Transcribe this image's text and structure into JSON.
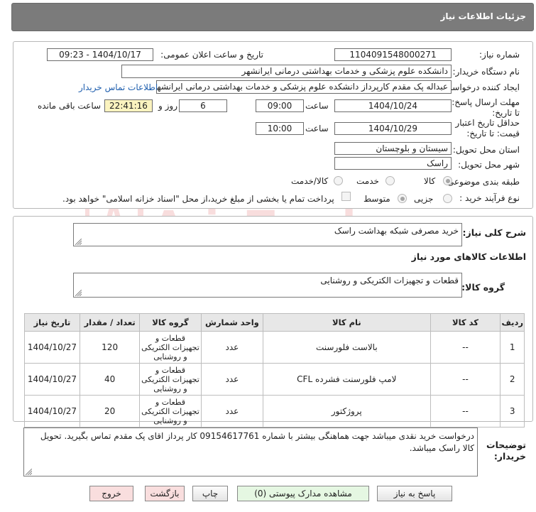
{
  "header": {
    "title": "جزئیات اطلاعات نیاز"
  },
  "form": {
    "need_number_label": "شماره نیاز:",
    "need_number": "1104091548000271",
    "announce_label": "تاریخ و ساعت اعلان عمومی:",
    "announce_value": "1404/10/17 - 09:23",
    "buyer_org_label": "نام دستگاه خریدار:",
    "buyer_org": "دانشکده علوم پزشکی و خدمات بهداشتی درمانی ایرانشهر",
    "requester_label": "ایجاد کننده درخواست:",
    "requester": "عبداله پک مقدم کارپرداز دانشکده علوم پزشکی و خدمات بهداشتی درمانی ایرانشهر",
    "contact_link": "اطلاعات تماس خریدار",
    "reply_deadline_label": "مهلت ارسال پاسخ: تا تاریخ:",
    "reply_date": "1404/10/24",
    "time_label": "ساعت",
    "reply_time": "09:00",
    "days_value": "6",
    "days_label": "روز و",
    "remaining_time": "22:41:16",
    "remaining_label": "ساعت باقی مانده",
    "validity_label": "حداقل تاریخ اعتبار قیمت: تا تاریخ:",
    "validity_date": "1404/10/29",
    "validity_time": "10:00",
    "province_label": "استان محل تحویل:",
    "province": "سیستان و بلوچستان",
    "city_label": "شهر محل تحویل:",
    "city": "راسک",
    "category_label": "طبقه بندی موضوعی:",
    "category_options": [
      "کالا",
      "خدمت",
      "کالا/خدمت"
    ],
    "process_label": "نوع فرآیند خرید :",
    "process_options": [
      "جزیی",
      "متوسط"
    ],
    "payment_note": "پرداخت تمام یا بخشی از مبلغ خرید،از محل \"اسناد خزانه اسلامی\" خواهد بود."
  },
  "summary": {
    "label": "شرح کلی نیاز:",
    "value": "خرید مصرفی شبکه بهداشت راسک",
    "goods_info_title": "اطلاعات کالاهای مورد نیاز",
    "goods_group_label": "گروه کالا:",
    "goods_group_value": "قطعات و تجهیزات الکتریکی و روشنایی"
  },
  "table": {
    "headers": [
      "ردیف",
      "کد کالا",
      "نام کالا",
      "واحد شمارش",
      "گروه کالا",
      "تعداد / مقدار",
      "تاریخ نیاز"
    ],
    "rows": [
      [
        "1",
        "--",
        "بالاست فلورسنت",
        "عدد",
        "قطعات و تجهیزات الکتریکی و روشنایی",
        "120",
        "1404/10/27"
      ],
      [
        "2",
        "--",
        "لامپ فلورسنت فشرده CFL",
        "عدد",
        "قطعات و تجهیزات الکتریکی و روشنایی",
        "40",
        "1404/10/27"
      ],
      [
        "3",
        "--",
        "پروژکتور",
        "عدد",
        "قطعات و تجهیزات الکتریکی و روشنایی",
        "20",
        "1404/10/27"
      ]
    ]
  },
  "notes": {
    "label": "توضیحات خریدار:",
    "value": "درخواست خرید نقدی میباشد جهت هماهنگی بیشتر با شماره 09154617761 کار پرداز اقای پک مقدم تماس بگیرید. تحویل کالا راسک میباشد."
  },
  "buttons": {
    "reply": "پاسخ به نیاز",
    "view_docs": "مشاهده مدارک پیوستی (0)",
    "print": "چاپ",
    "back": "بازگشت",
    "exit": "خروج"
  },
  "watermark": {
    "text": "AriaTender.neT"
  },
  "colors": {
    "titlebar": "#7b7b7b",
    "remaining_bg": "#fbf3bf",
    "link": "#1f5fae"
  }
}
